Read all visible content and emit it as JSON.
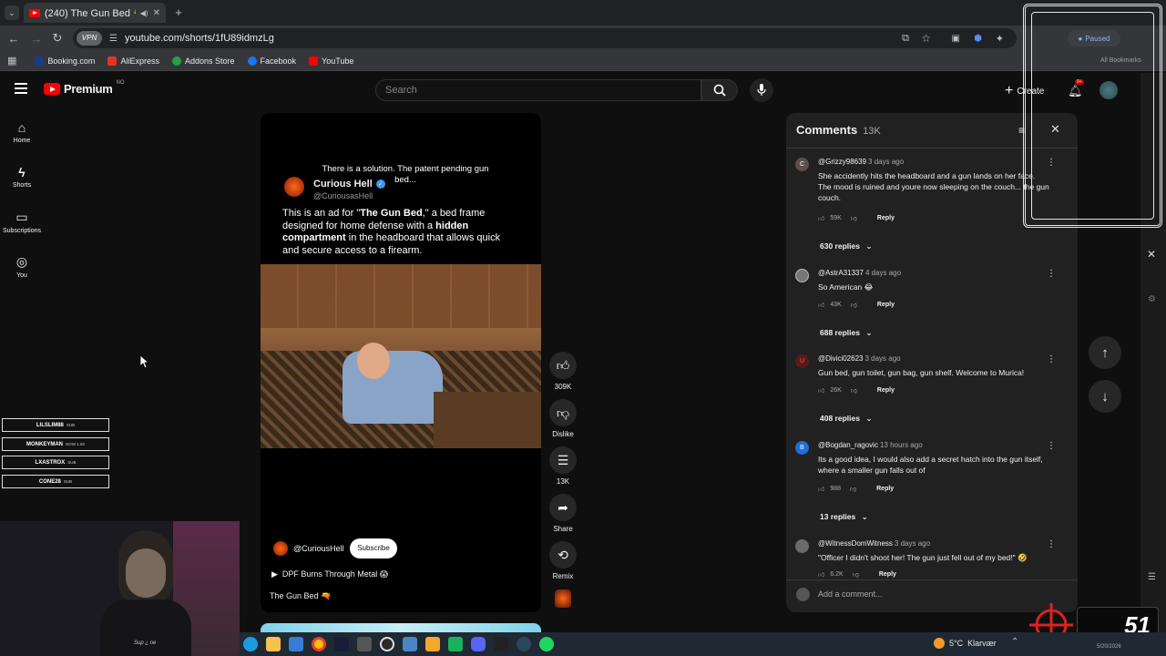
{
  "browser": {
    "tab_title": "(240) The Gun Bed 🔫 - You",
    "url": "youtube.com/shorts/1fU89idmzLg",
    "bookmarks": [
      {
        "label": "Booking.com",
        "color": "#1a3a8a"
      },
      {
        "label": "AliExpress",
        "color": "#e43225"
      },
      {
        "label": "Addons Store",
        "color": "#2a9d4b"
      },
      {
        "label": "Facebook",
        "color": "#1877f2"
      },
      {
        "label": "YouTube",
        "color": "#ff0000"
      }
    ],
    "all_bookmarks": "All Bookmarks",
    "profile_status": "Paused"
  },
  "youtube": {
    "logo_text": "Premium",
    "logo_region": "NO",
    "search_placeholder": "Search",
    "create_label": "Create",
    "notifications_badge": "9+",
    "nav": [
      {
        "label": "Home",
        "icon": "home-icon"
      },
      {
        "label": "Shorts",
        "icon": "shorts-icon"
      },
      {
        "label": "Subscriptions",
        "icon": "subscriptions-icon"
      },
      {
        "label": "You",
        "icon": "you-icon"
      }
    ]
  },
  "video": {
    "caption_overlay": "There is a solution. The patent pending gun bed...",
    "post_author": "Curious Hell",
    "post_handle": "@CuriousasHell",
    "post_text_parts": [
      {
        "text": "This is an ad for \"",
        "bold": false
      },
      {
        "text": "The Gun Bed",
        "bold": true
      },
      {
        "text": ",\" a bed frame designed for home defense with a ",
        "bold": false
      },
      {
        "text": "hidden compartment",
        "bold": true
      },
      {
        "text": " in the headboard that allows quick and secure access to a firearm.",
        "bold": false
      }
    ],
    "channel": "@CuriousHell",
    "subscribe_label": "Subscribe",
    "music": "DPF Burns Through Metal 😱",
    "title": "The Gun Bed 🔫"
  },
  "actions": {
    "likes": "309K",
    "dislike_label": "Dislike",
    "comments_count": "13K",
    "share_label": "Share",
    "remix_label": "Remix"
  },
  "comments": {
    "title": "Comments",
    "count": "13K",
    "add_placeholder": "Add a comment...",
    "items": [
      {
        "author": "@Grizzy98639",
        "time": "3 days ago",
        "avatar_letter": "C",
        "avatar_color": "#5d4e4a",
        "text": "She accidently hits the headboard and a gun lands on her face. The mood is ruined and youre now sleeping on the couch... the gun couch.",
        "likes": "59K",
        "reply_label": "Reply",
        "replies": "630 replies"
      },
      {
        "author": "@AstrA31337",
        "time": "4 days ago",
        "avatar_letter": "",
        "avatar_color": "#777777",
        "text": "So American 😂",
        "likes": "43K",
        "reply_label": "Reply",
        "replies": "688 replies"
      },
      {
        "author": "@Divici02623",
        "time": "3 days ago",
        "avatar_letter": "U",
        "avatar_color": "#5a1a1a",
        "text": "Gun bed, gun toilet, gun bag, gun shelf. Welcome to Murica!",
        "likes": "26K",
        "reply_label": "Reply",
        "replies": "408 replies"
      },
      {
        "author": "@Bogdan_ragovic",
        "time": "13 hours ago",
        "avatar_letter": "B",
        "avatar_color": "#1e6fd9",
        "text": "Its a good idea, I would also add a secret hatch into the gun itself, where a smaller gun falls out of",
        "likes": "988",
        "reply_label": "Reply",
        "replies": "13 replies"
      },
      {
        "author": "@WitnessDomWitness",
        "time": "3 days ago",
        "avatar_letter": "",
        "avatar_color": "#6b6b6b",
        "text": "\"Officer I didn't shoot her! The gun just fell out of my bed!\" 🤣",
        "likes": "6.2K",
        "reply_label": "Reply",
        "replies": ""
      }
    ]
  },
  "stream_overlay": {
    "subs": [
      {
        "name": "LILSLIM88",
        "tag": "SUB"
      },
      {
        "name": "MONKEYMAN",
        "tag": "NOW 1.60"
      },
      {
        "name": "LXASTROX",
        "tag": "SUB"
      },
      {
        "name": "CONE28",
        "tag": "SUB"
      }
    ],
    "counter": "51",
    "webcam_caption": "Sup ¿ ne"
  },
  "taskbar": {
    "weather": "5°C  Klarvær",
    "date": "5/20/2026"
  }
}
